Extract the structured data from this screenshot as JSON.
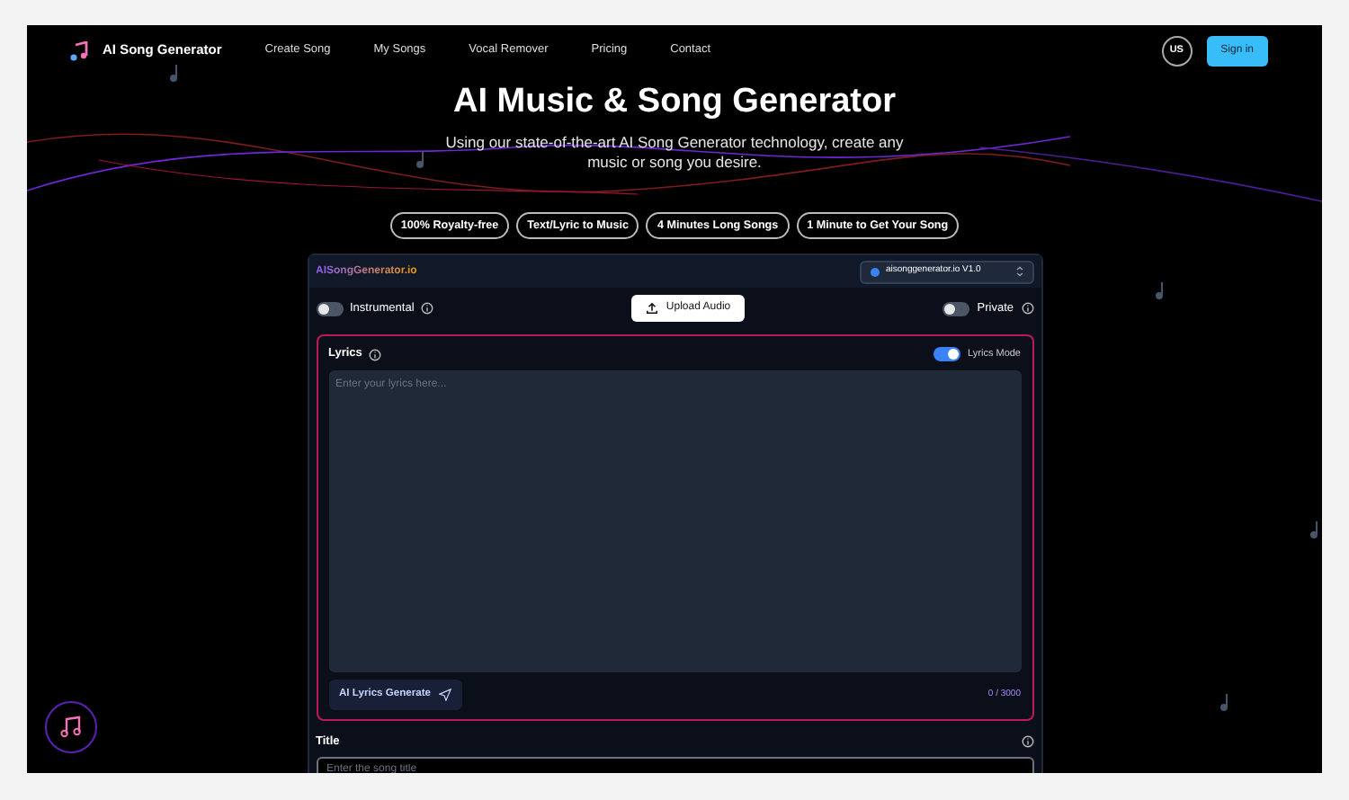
{
  "nav": {
    "brand": "AI Song Generator",
    "links": [
      "Create Song",
      "My Songs",
      "Vocal Remover",
      "Pricing",
      "Contact"
    ],
    "language": "US",
    "sign_in": "Sign in"
  },
  "hero": {
    "title": "AI Music & Song Generator",
    "subtitle": "Using our state-of-the-art AI Song Generator technology, create any music or song you desire."
  },
  "features": [
    "100% Royalty-free",
    "Text/Lyric to Music",
    "4 Minutes Long Songs",
    "1 Minute to Get Your Song"
  ],
  "generator": {
    "site_label": "AISongGenerator.io",
    "model": "aisonggenerator.io V1.0",
    "toggles": [
      {
        "label": "Instrumental",
        "on": false
      },
      {
        "label": "Private",
        "on": false
      }
    ],
    "upload": "Upload Audio",
    "lyrics": {
      "label": "Lyrics",
      "mode_label": "Lyrics Mode",
      "mode_on": true,
      "placeholder": "Enter your lyrics here...",
      "generate": "AI Lyrics Generate",
      "count": "0 / 3000"
    },
    "title": {
      "label": "Title",
      "placeholder": "Enter the song title"
    }
  }
}
